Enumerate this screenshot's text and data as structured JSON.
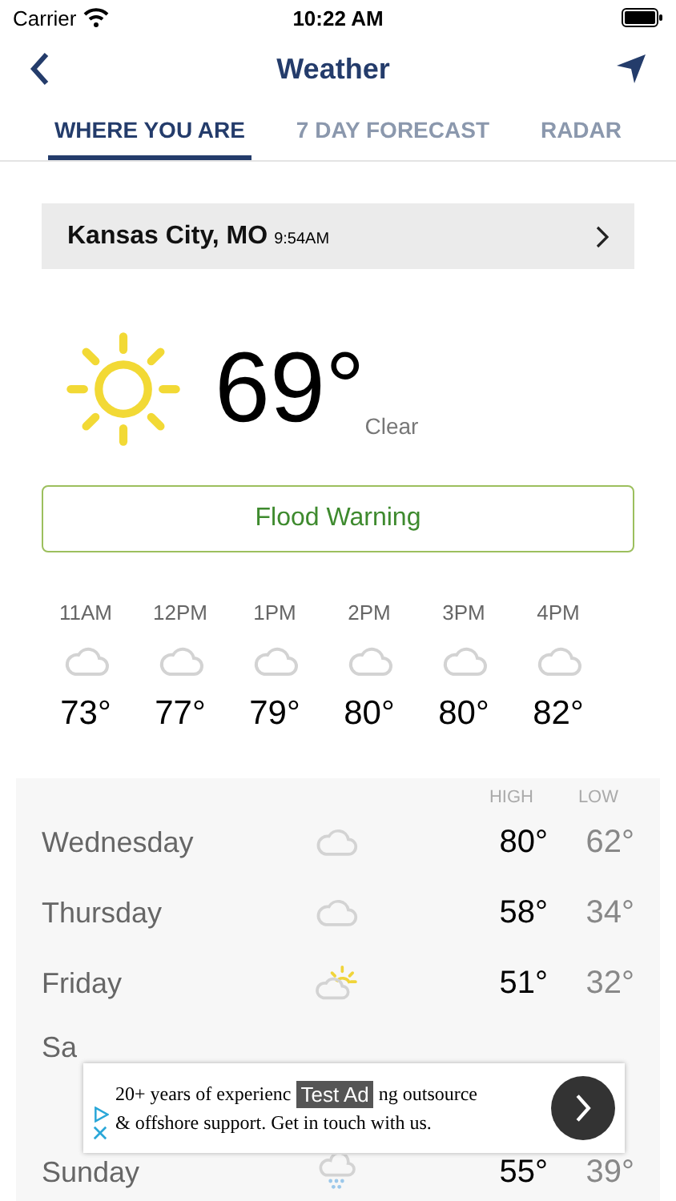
{
  "status_bar": {
    "carrier": "Carrier",
    "time": "10:22 AM"
  },
  "nav": {
    "title": "Weather"
  },
  "tabs": [
    {
      "label": "WHERE YOU ARE",
      "selected": true
    },
    {
      "label": "7 DAY FORECAST",
      "selected": false
    },
    {
      "label": "RADAR",
      "selected": false
    }
  ],
  "location": {
    "city": "Kansas City, MO",
    "time": "9:54AM"
  },
  "current": {
    "temperature": "69°",
    "condition": "Clear"
  },
  "alert": {
    "label": "Flood Warning"
  },
  "hourly": [
    {
      "time": "11AM",
      "kind": "cloud",
      "temp": "73°"
    },
    {
      "time": "12PM",
      "kind": "cloud",
      "temp": "77°"
    },
    {
      "time": "1PM",
      "kind": "cloud",
      "temp": "79°"
    },
    {
      "time": "2PM",
      "kind": "cloud",
      "temp": "80°"
    },
    {
      "time": "3PM",
      "kind": "cloud",
      "temp": "80°"
    },
    {
      "time": "4PM",
      "kind": "cloud",
      "temp": "82°"
    }
  ],
  "daily": {
    "high_label": "HIGH",
    "low_label": "LOW",
    "rows": [
      {
        "day": "Wednesday",
        "kind": "cloud",
        "high": "80°",
        "low": "62°"
      },
      {
        "day": "Thursday",
        "kind": "cloud",
        "high": "58°",
        "low": "34°"
      },
      {
        "day": "Friday",
        "kind": "partly-sunny",
        "high": "51°",
        "low": "32°"
      },
      {
        "day": "Sa"
      },
      {
        "day": "Sunday",
        "kind": "rain",
        "high": "55°",
        "low": "39°"
      }
    ]
  },
  "ad": {
    "badge": "Test Ad",
    "line1_start": "20+ years of experienc",
    "line1_end": "ng outsource",
    "line2": "& offshore support. Get in touch with us."
  }
}
